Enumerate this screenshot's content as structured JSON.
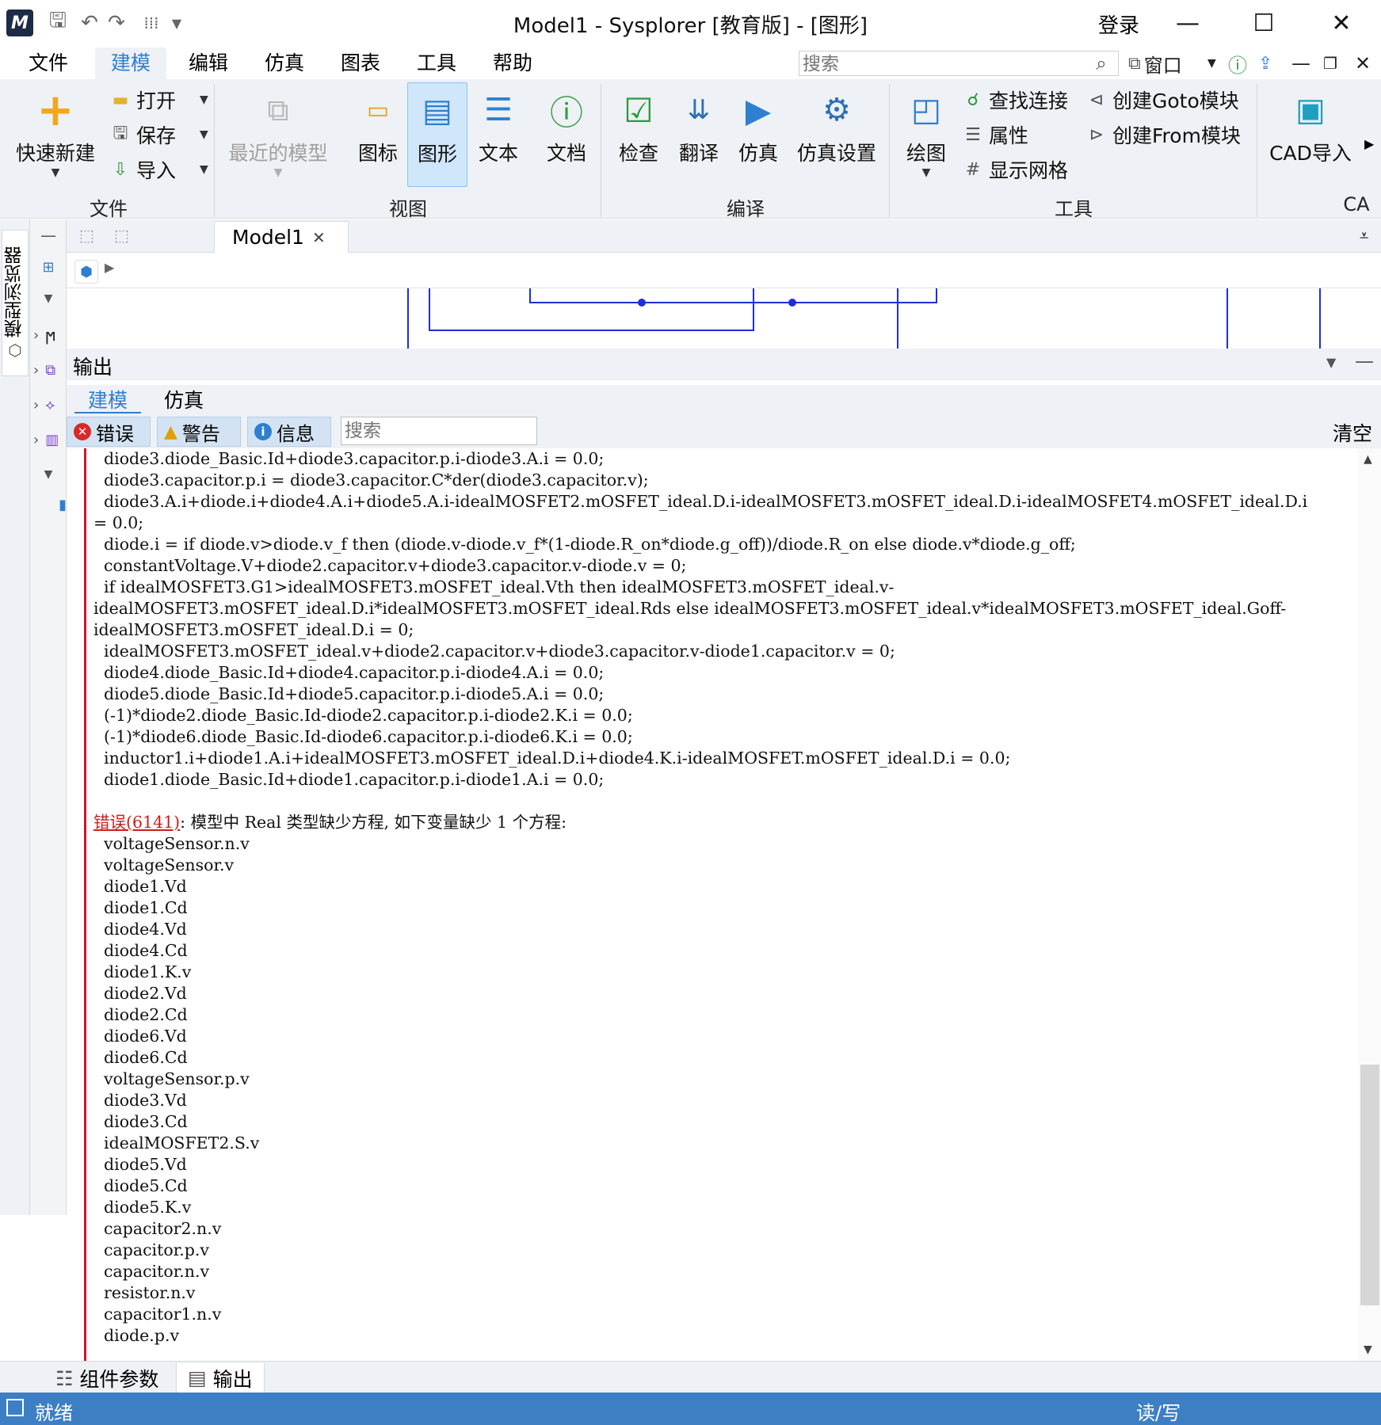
{
  "titlebar": {
    "title": "Model1 - Sysplorer [教育版] - [图形]",
    "login": "登录",
    "logo": "M"
  },
  "menu": {
    "items": [
      "文件",
      "建模",
      "编辑",
      "仿真",
      "图表",
      "工具",
      "帮助"
    ],
    "active_index": 1,
    "search_placeholder": "搜索",
    "window_label": "窗口"
  },
  "ribbon": {
    "file_group": {
      "label": "文件",
      "quick_new": "快速新建",
      "open": "打开",
      "save": "保存",
      "import": "导入"
    },
    "view_group": {
      "label": "视图",
      "recent": "最近的模型",
      "icon": "图标",
      "graphic": "图形",
      "text": "文本",
      "doc": "文档"
    },
    "compile_group": {
      "label": "编译",
      "check": "检查",
      "translate": "翻译",
      "simulate": "仿真",
      "sim_settings": "仿真设置"
    },
    "tools_group": {
      "label": "工具",
      "draw": "绘图",
      "find_conn": "查找连接",
      "props": "属性",
      "grid": "显示网格",
      "goto": "创建Goto模块",
      "from": "创建From模块"
    },
    "cad_group": {
      "label": "CA",
      "cad_import": "CAD导入"
    }
  },
  "left": {
    "browser_tab": "模型浏览器"
  },
  "document": {
    "tab_label": "Model1"
  },
  "output": {
    "title": "输出",
    "tabs": [
      "建模",
      "仿真"
    ],
    "filters": {
      "error": "错误",
      "warning": "警告",
      "info": "信息"
    },
    "search_placeholder": "搜索",
    "clear": "清空"
  },
  "log": {
    "lines": [
      "  diode3.diode_Basic.Id+diode3.capacitor.p.i-diode3.A.i = 0.0;",
      "  diode3.capacitor.p.i = diode3.capacitor.C*der(diode3.capacitor.v);",
      "  diode3.A.i+diode.i+diode4.A.i+diode5.A.i-idealMOSFET2.mOSFET_ideal.D.i-idealMOSFET3.mOSFET_ideal.D.i-idealMOSFET4.mOSFET_ideal.D.i",
      "= 0.0;",
      "  diode.i = if diode.v>diode.v_f then (diode.v-diode.v_f*(1-diode.R_on*diode.g_off))/diode.R_on else diode.v*diode.g_off;",
      "  constantVoltage.V+diode2.capacitor.v+diode3.capacitor.v-diode.v = 0;",
      "  if idealMOSFET3.G1>idealMOSFET3.mOSFET_ideal.Vth then idealMOSFET3.mOSFET_ideal.v-",
      "idealMOSFET3.mOSFET_ideal.D.i*idealMOSFET3.mOSFET_ideal.Rds else idealMOSFET3.mOSFET_ideal.v*idealMOSFET3.mOSFET_ideal.Goff-",
      "idealMOSFET3.mOSFET_ideal.D.i = 0;",
      "  idealMOSFET3.mOSFET_ideal.v+diode2.capacitor.v+diode3.capacitor.v-diode1.capacitor.v = 0;",
      "  diode4.diode_Basic.Id+diode4.capacitor.p.i-diode4.A.i = 0.0;",
      "  diode5.diode_Basic.Id+diode5.capacitor.p.i-diode5.A.i = 0.0;",
      "  (-1)*diode2.diode_Basic.Id-diode2.capacitor.p.i-diode2.K.i = 0.0;",
      "  (-1)*diode6.diode_Basic.Id-diode6.capacitor.p.i-diode6.K.i = 0.0;",
      "  inductor1.i+diode1.A.i+idealMOSFET3.mOSFET_ideal.D.i+diode4.K.i-idealMOSFET.mOSFET_ideal.D.i = 0.0;",
      "  diode1.diode_Basic.Id+diode1.capacitor.p.i-diode1.A.i = 0.0;",
      ""
    ],
    "error_link": "错误(6141)",
    "error_message": ": 模型中 Real 类型缺少方程, 如下变量缺少 1 个方程:",
    "missing_vars": [
      "  voltageSensor.n.v",
      "  voltageSensor.v",
      "  diode1.Vd",
      "  diode1.Cd",
      "  diode4.Vd",
      "  diode4.Cd",
      "  diode1.K.v",
      "  diode2.Vd",
      "  diode2.Cd",
      "  diode6.Vd",
      "  diode6.Cd",
      "  voltageSensor.p.v",
      "  diode3.Vd",
      "  diode3.Cd",
      "  idealMOSFET2.S.v",
      "  diode5.Vd",
      "  diode5.Cd",
      "  diode5.K.v",
      "  capacitor2.n.v",
      "  capacitor.p.v",
      "  capacitor.n.v",
      "  resistor.n.v",
      "  capacitor1.n.v",
      "  diode.p.v"
    ]
  },
  "bottom": {
    "tabs": [
      "组件参数",
      "输出"
    ],
    "active_index": 1
  },
  "status": {
    "left": "就绪",
    "right": "读/写"
  },
  "colors": {
    "accent": "#2e7fd0",
    "status_bar": "#3d7fc4",
    "error_red": "#c8182c",
    "wire_blue": "#1f2fd6"
  }
}
